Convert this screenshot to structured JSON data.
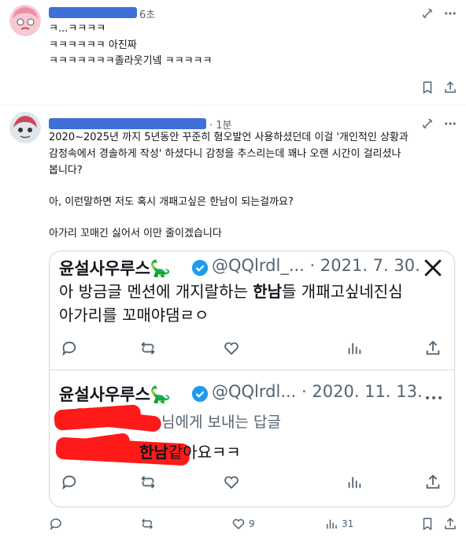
{
  "post1": {
    "time": "6초",
    "lines": [
      "ㅋ...ㅋㅋㅋㅋ",
      "ㅋㅋㅋㅋㅋㅋ 아진짜",
      "ㅋㅋㅋㅋㅋㅋㅋ졸라웃기넼 ㅋㅋㅋㅋㅋ"
    ]
  },
  "post2": {
    "time": "· 1분",
    "lines": [
      "2020~2025년 까지 5년동안 꾸준히 혐오발언 사용하셨던데 이걸 '개인적인 상황과",
      "감정속에서 경솔하게 작성' 하셨다니 감정을 추스리는데 꽤나 오랜 시간이 걸리셨나",
      "봅니다?",
      "",
      "아, 이런말하면 저도 혹시 개패고싶은 한남이 되는걸까요?",
      "",
      "아가리 꼬매긴 싫어서 이만 줄이겠습니다"
    ],
    "actions": {
      "likes": "9",
      "views": "31"
    }
  },
  "embed1": {
    "name": "윤설사우루스🦕",
    "handle": "@QQlrdl_... · 2021. 7. 30.",
    "text_line1_a": "아 방금글 멘션에 개지랄하는 ",
    "text_line1_b": "한남",
    "text_line1_c": "들 개패고싶네진심",
    "text_line2": "아가리를 꼬매야댐ㄹㅇ"
  },
  "embed2": {
    "name": "윤설사우루스🦕",
    "handle": "@QQlrdl... · 2020. 11. 13.",
    "text_line1": "님에게 보내는 답글",
    "text_line2_b": "한남",
    "text_line2_c": "같아요ㅋㅋ"
  },
  "icons": {
    "reply": "reply-icon",
    "retweet": "retweet-icon",
    "like": "heart-icon",
    "views": "views-icon",
    "share": "share-icon",
    "grok": "grok-icon",
    "more": "more-icon",
    "x_logo": "x-logo-icon"
  },
  "colors": {
    "accent_verified": "#1d9bf0",
    "redaction_red": "#ff1a1a",
    "redaction_blue": "#3f6fd8"
  }
}
